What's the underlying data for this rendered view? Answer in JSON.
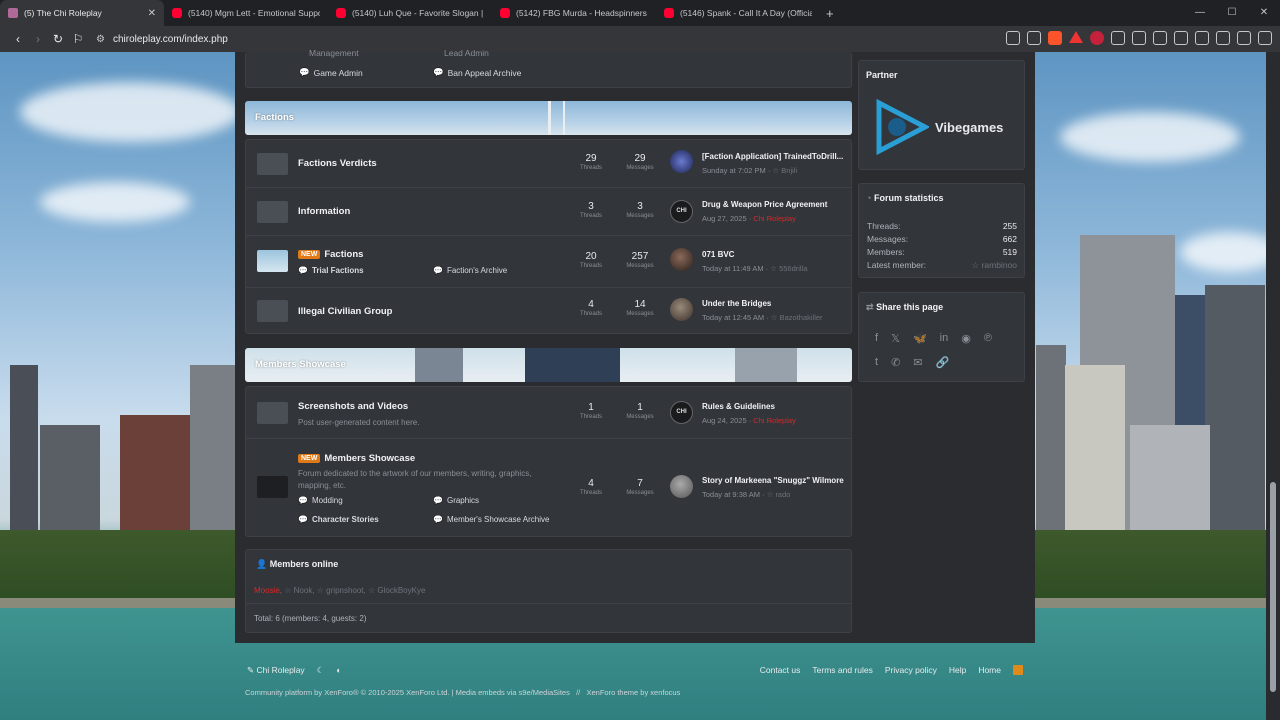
{
  "browser": {
    "tabs": [
      {
        "title": "(5) The Chi Roleplay",
        "active": true,
        "icon": "chi-favicon"
      },
      {
        "title": "(5140) Mgm Lett - Emotional Suppo",
        "active": false,
        "icon": "youtube-favicon"
      },
      {
        "title": "(5140) Luh Que - Favorite Slogan || T",
        "active": false,
        "icon": "youtube-favicon"
      },
      {
        "title": "(5142) FBG Murda - Headspinners (C",
        "active": false,
        "icon": "youtube-favicon"
      },
      {
        "title": "(5146) Spank - Call It A Day (Official",
        "active": false,
        "icon": "youtube-favicon"
      }
    ],
    "url": "chiroleplay.com/index.php"
  },
  "top_fragment": {
    "items": [
      "Game Admin",
      "Ban Appeal Archive"
    ],
    "partial_items": [
      "Management",
      "Lead Admin"
    ]
  },
  "categories": {
    "factions": {
      "title": "Factions",
      "nodes": [
        {
          "title": "Factions Verdicts",
          "threads": "29",
          "messages": "29",
          "latest_title": "[Faction Application] TrainedToDrill...",
          "latest_time": "Sunday at 7:02 PM",
          "latest_user": "Bnjili"
        },
        {
          "title": "Information",
          "threads": "3",
          "messages": "3",
          "latest_title": "Drug & Weapon Price Agreement",
          "latest_time": "Aug 27, 2025",
          "latest_user": "Chi Roleplay"
        },
        {
          "title": "Factions",
          "new": "NEW",
          "threads": "20",
          "messages": "257",
          "latest_title": "071 BVC",
          "latest_time": "Today at 11:49 AM",
          "latest_user": "556drilla",
          "subforums": [
            "Trial Factions",
            "Faction's Archive"
          ]
        },
        {
          "title": "Illegal Civilian Group",
          "threads": "4",
          "messages": "14",
          "latest_title": "Under the Bridges",
          "latest_time": "Today at 12:45 AM",
          "latest_user": "Bazothakiller"
        }
      ]
    },
    "showcase": {
      "title": "Members Showcase",
      "nodes": [
        {
          "title": "Screenshots and Videos",
          "description": "Post user-generated content here.",
          "threads": "1",
          "messages": "1",
          "latest_title": "Rules & Guidelines",
          "latest_time": "Aug 24, 2025",
          "latest_user": "Chi Roleplay"
        },
        {
          "title": "Members Showcase",
          "new": "NEW",
          "description": "Forum dedicated to the artwork of our members, writing, graphics, mapping, etc.",
          "threads": "4",
          "messages": "7",
          "latest_title": "Story of Markeena \"Snuggz\" Wilmore",
          "latest_time": "Today at 9:38 AM",
          "latest_user": "rado",
          "subforums": [
            "Modding",
            "Graphics",
            "Character Stories",
            "Member's Showcase Archive"
          ]
        }
      ]
    }
  },
  "labels": {
    "threads": "Threads",
    "messages": "Messages"
  },
  "members_online": {
    "title": "Members online",
    "users": [
      "Moosie",
      "Nook",
      "gripnshoot",
      "GlockBoyKye"
    ],
    "total": "Total: 6 (members: 4, guests: 2)"
  },
  "sidebar": {
    "partner_title": "Partner",
    "partner_logo": "Vibegames",
    "stats_title": "Forum statistics",
    "stats": [
      {
        "label": "Threads:",
        "value": "255"
      },
      {
        "label": "Messages:",
        "value": "662"
      },
      {
        "label": "Members:",
        "value": "519"
      },
      {
        "label": "Latest member:",
        "value": "rambinoo"
      }
    ],
    "share_title": "Share this page",
    "share_icons": [
      "facebook-icon",
      "x-icon",
      "bluesky-icon",
      "linkedin-icon",
      "reddit-icon",
      "pinterest-icon",
      "tumblr-icon",
      "whatsapp-icon",
      "email-icon",
      "link-icon"
    ]
  },
  "footer": {
    "brand": "Chi Roleplay",
    "links": [
      "Contact us",
      "Terms and rules",
      "Privacy policy",
      "Help",
      "Home"
    ],
    "copyright": "Community platform by XenForo® © 2010-2025 XenForo Ltd. | Media embeds via s9e/MediaSites",
    "theme": "XenForo theme by xenfocus"
  },
  "colors": {
    "accent_new": "#e07a19",
    "staff_red": "#d42a2a",
    "panel": "#32353a",
    "page": "#2a2c30"
  }
}
